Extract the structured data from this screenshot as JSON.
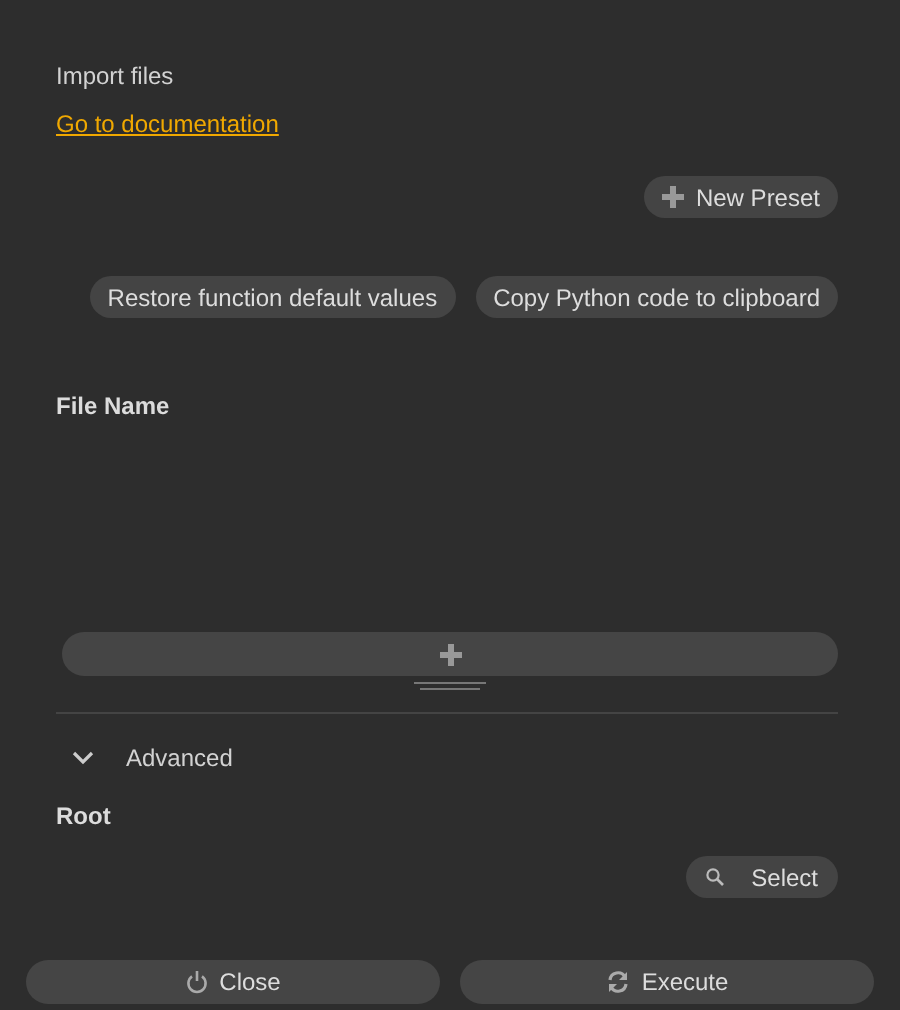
{
  "title": "Import files",
  "documentation_link": "Go to documentation",
  "new_preset_button": "New Preset",
  "action_buttons": [
    "Restore function default values",
    "Copy Python code to clipboard"
  ],
  "file_list": {
    "label": "File Name"
  },
  "advanced": {
    "label": "Advanced",
    "expanded": true
  },
  "root": {
    "label": "Root",
    "button": "Select"
  },
  "footer_buttons": [
    {
      "kind": "close",
      "label": "Close"
    },
    {
      "kind": "execute",
      "label": "Execute"
    }
  ]
}
